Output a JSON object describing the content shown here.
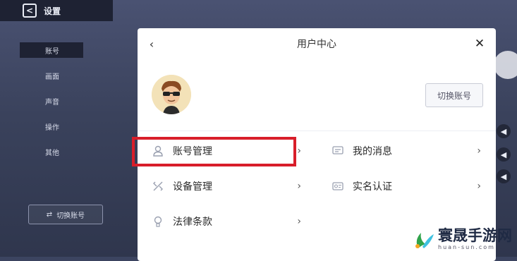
{
  "background": {
    "title": "设置",
    "sidebar_items": [
      {
        "label": "账号"
      },
      {
        "label": "画面"
      },
      {
        "label": "声音"
      },
      {
        "label": "操作"
      },
      {
        "label": "其他"
      }
    ],
    "switch_button": "切换账号"
  },
  "dialog": {
    "title": "用户中心",
    "switch_account": "切换账号",
    "menu": [
      {
        "label": "账号管理",
        "icon": "person-icon"
      },
      {
        "label": "我的消息",
        "icon": "message-icon"
      },
      {
        "label": "设备管理",
        "icon": "device-icon"
      },
      {
        "label": "实名认证",
        "icon": "id-card-icon"
      },
      {
        "label": "法律条款",
        "icon": "bulb-icon"
      }
    ],
    "highlight_color": "#d81e2a"
  },
  "watermark": {
    "text": "寰晟手游网",
    "sub": "huan-sun.com"
  }
}
